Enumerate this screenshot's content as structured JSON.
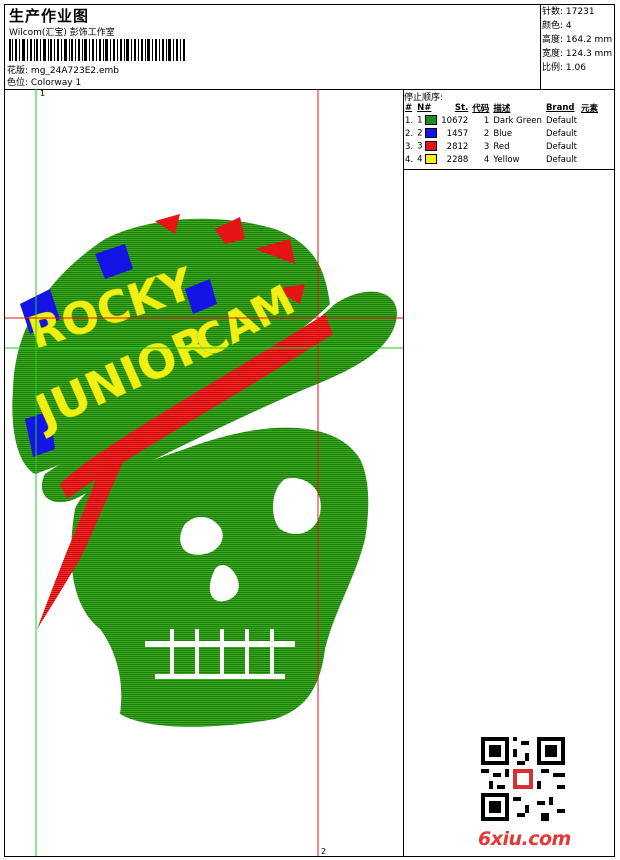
{
  "header": {
    "title": "生产作业图",
    "company": "Wilcom(汇宝) 彭饰工作室",
    "design_label": "花版:",
    "design_file": "mg_24A723E2.emb",
    "colorway_label": "色位:",
    "colorway": "Colorway 1"
  },
  "specs": [
    {
      "label": "针数:",
      "value": "17231"
    },
    {
      "label": "颜色:",
      "value": "4"
    },
    {
      "label": "高度:",
      "value": "164.2 mm"
    },
    {
      "label": "宽度:",
      "value": "124.3 mm"
    },
    {
      "label": "比例:",
      "value": "1.06"
    }
  ],
  "stop_sequence": {
    "title": "停止顺序:",
    "columns": [
      "#",
      "N#",
      "St.",
      "代码",
      "描述",
      "Brand",
      "元素"
    ],
    "rows": [
      {
        "num": "1.",
        "n": "1",
        "color": "#1e8c1e",
        "stitches": "10672",
        "code": "1",
        "desc": "Dark Green",
        "brand": "Default"
      },
      {
        "num": "2.",
        "n": "2",
        "color": "#1414e6",
        "stitches": "1457",
        "code": "2",
        "desc": "Blue",
        "brand": "Default"
      },
      {
        "num": "3.",
        "n": "3",
        "color": "#e61414",
        "stitches": "2812",
        "code": "3",
        "desc": "Red",
        "brand": "Default"
      },
      {
        "num": "4.",
        "n": "4",
        "color": "#f0f014",
        "stitches": "2288",
        "code": "4",
        "desc": "Yellow",
        "brand": "Default"
      }
    ]
  },
  "design": {
    "text_line1": "ROCKY",
    "text_line2": "JUNIOR",
    "text_line3": "CAM",
    "colors": {
      "green": "#2e9e14",
      "blue": "#1414e6",
      "red": "#e61414",
      "yellow": "#f0f014"
    }
  },
  "guides": {
    "marker1": "1",
    "marker2": "2"
  },
  "watermark": "6xiu.com"
}
